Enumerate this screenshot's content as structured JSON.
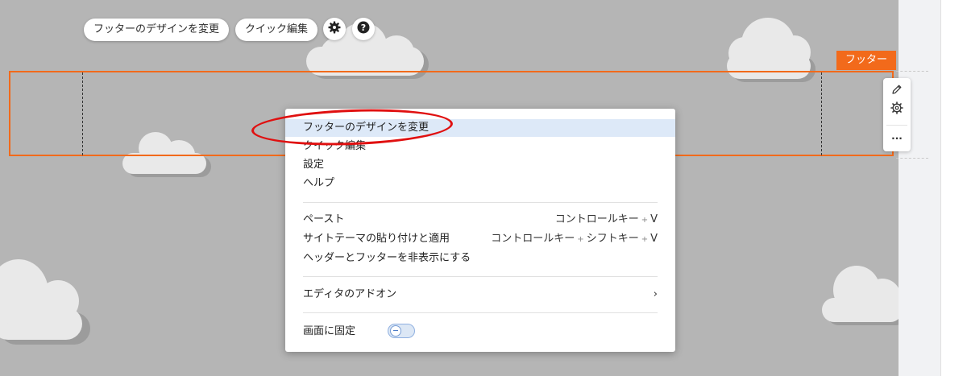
{
  "toolbar": {
    "change_footer_design": "フッターのデザインを変更",
    "quick_edit": "クイック編集",
    "settings_icon": "gear-icon",
    "help_icon": "question-icon"
  },
  "footer_tag": "フッター",
  "side_tools": {
    "edit_icon": "pencil-icon",
    "settings_icon": "gear-outline-icon",
    "more": "···"
  },
  "context_menu": {
    "items_group1": [
      {
        "label": "フッターのデザインを変更",
        "highlighted": true
      },
      {
        "label": "クイック編集"
      },
      {
        "label": "設定"
      },
      {
        "label": "ヘルプ"
      }
    ],
    "items_group2": [
      {
        "label": "ペースト",
        "shortcut": [
          "コントロールキー",
          "V"
        ]
      },
      {
        "label": "サイトテーマの貼り付けと適用",
        "shortcut": [
          "コントロールキー",
          "シフトキー",
          "V"
        ]
      },
      {
        "label": "ヘッダーとフッターを非表示にする"
      }
    ],
    "addons": {
      "label": "エディタのアドオン",
      "chevron": "›"
    },
    "pin": {
      "label": "画面に固定",
      "toggle_on": false
    }
  },
  "colors": {
    "accent_orange": "#f26a1b",
    "highlight_blue": "#dde9f8",
    "annotation_red": "#e01010",
    "canvas_gray": "#b5b5b5"
  }
}
